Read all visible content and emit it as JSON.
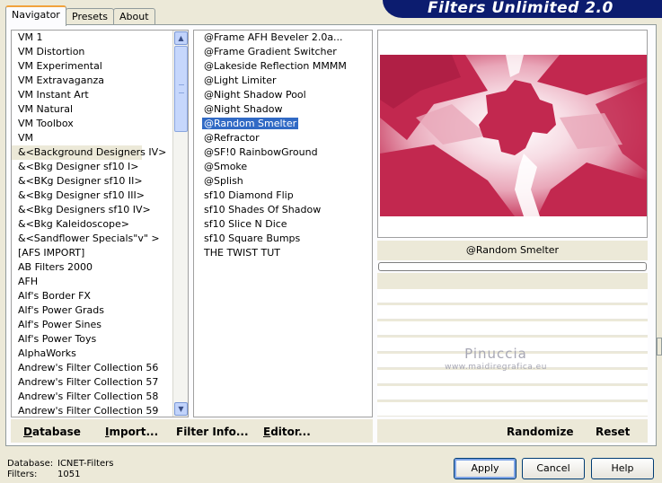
{
  "app": {
    "title": "Filters Unlimited 2.0"
  },
  "tabs": [
    {
      "label": "Navigator",
      "active": true
    },
    {
      "label": "Presets",
      "active": false
    },
    {
      "label": "About",
      "active": false
    }
  ],
  "categories": {
    "selected_index": 8,
    "items": [
      "VM 1",
      "VM Distortion",
      "VM Experimental",
      "VM Extravaganza",
      "VM Instant Art",
      "VM Natural",
      "VM Toolbox",
      "VM",
      "&<Background Designers IV>",
      "&<Bkg Designer sf10 I>",
      "&<BKg Designer sf10 II>",
      "&<Bkg Designer sf10 III>",
      "&<Bkg Designers sf10 IV>",
      "&<Bkg Kaleidoscope>",
      "&<Sandflower Specials\"v\" >",
      "[AFS IMPORT]",
      "AB Filters 2000",
      "AFH",
      "Alf's Border FX",
      "Alf's Power Grads",
      "Alf's Power Sines",
      "Alf's Power Toys",
      "AlphaWorks",
      "Andrew's Filter Collection 56",
      "Andrew's Filter Collection 57",
      "Andrew's Filter Collection 58",
      "Andrew's Filter Collection 59"
    ],
    "scroll_up_icon": "arrow-up-icon",
    "scroll_down_icon": "arrow-down-icon"
  },
  "filters": {
    "selected_index": 6,
    "items": [
      "@Frame AFH Beveler 2.0a...",
      "@Frame Gradient Switcher",
      "@Lakeside Reflection MMMM",
      "@Light Limiter",
      "@Night Shadow Pool",
      "@Night Shadow",
      "@Random Smelter",
      "@Refractor",
      "@SF!0 RainbowGround",
      "@Smoke",
      "@Splish",
      "sf10 Diamond Flip",
      "sf10 Shades Of Shadow",
      "sf10 Slice N Dice",
      "sf10 Square Bumps",
      "THE TWIST TUT"
    ]
  },
  "preview": {
    "selected_filter_name": "@Random Smelter",
    "progress": 0,
    "colors": {
      "crimson": "#c2284f",
      "pink": "#e9a7b9",
      "light_pink": "#f7dce4"
    }
  },
  "watermark": {
    "name": "Pinuccia",
    "url": "www.maidiregrafica.eu"
  },
  "left_buttons": [
    {
      "label": "Database",
      "underline": "D",
      "rest": "atabase"
    },
    {
      "label": "Import...",
      "underline": "I",
      "rest": "mport..."
    },
    {
      "label": "Filter Info...",
      "underline": "",
      "rest": "Filter Info..."
    },
    {
      "label": "Editor...",
      "underline": "E",
      "rest": "ditor..."
    }
  ],
  "right_buttons": {
    "randomize": "Randomize",
    "reset": "Reset"
  },
  "status": {
    "database_label": "Database:",
    "database_value": "ICNET-Filters",
    "filters_label": "Filters:",
    "filters_value": "1051"
  },
  "dialog_buttons": {
    "apply": "Apply",
    "cancel": "Cancel",
    "help": "Help"
  }
}
